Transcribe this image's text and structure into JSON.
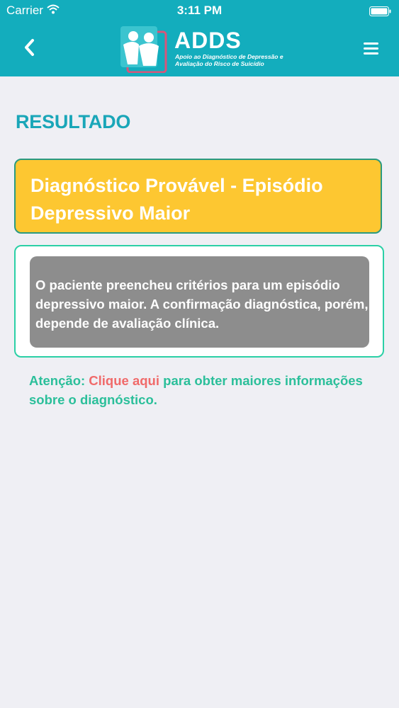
{
  "status_bar": {
    "carrier": "Carrier",
    "time": "3:11 PM"
  },
  "nav": {
    "back_icon": "chevron-left-icon",
    "menu_icon": "hamburger-menu-icon",
    "logo": {
      "title": "ADDS",
      "subtitle_line1": "Apoio ao Diagnóstico de Depressão e",
      "subtitle_line2": "Avaliação do Risco de Suicídio"
    }
  },
  "main": {
    "title": "RESULTADO",
    "diagnosis": "Diagnóstico Provável - Episódio Depressivo Maior",
    "description": "O paciente preencheu critérios para um episódio depressivo maior. A confirmação diagnóstica, porém, depende de avaliação clínica.",
    "attention_label": "Atenção:",
    "attention_link": "Clique aqui",
    "attention_rest": "para obter maiores informações sobre o diagnóstico."
  },
  "colors": {
    "header": "#13adbd",
    "title": "#1aa6b8",
    "diagnosis_bg": "#fdc731",
    "info_bg": "#8d8d8d",
    "attention": "#2bbf9a",
    "link": "#f06a6a"
  }
}
